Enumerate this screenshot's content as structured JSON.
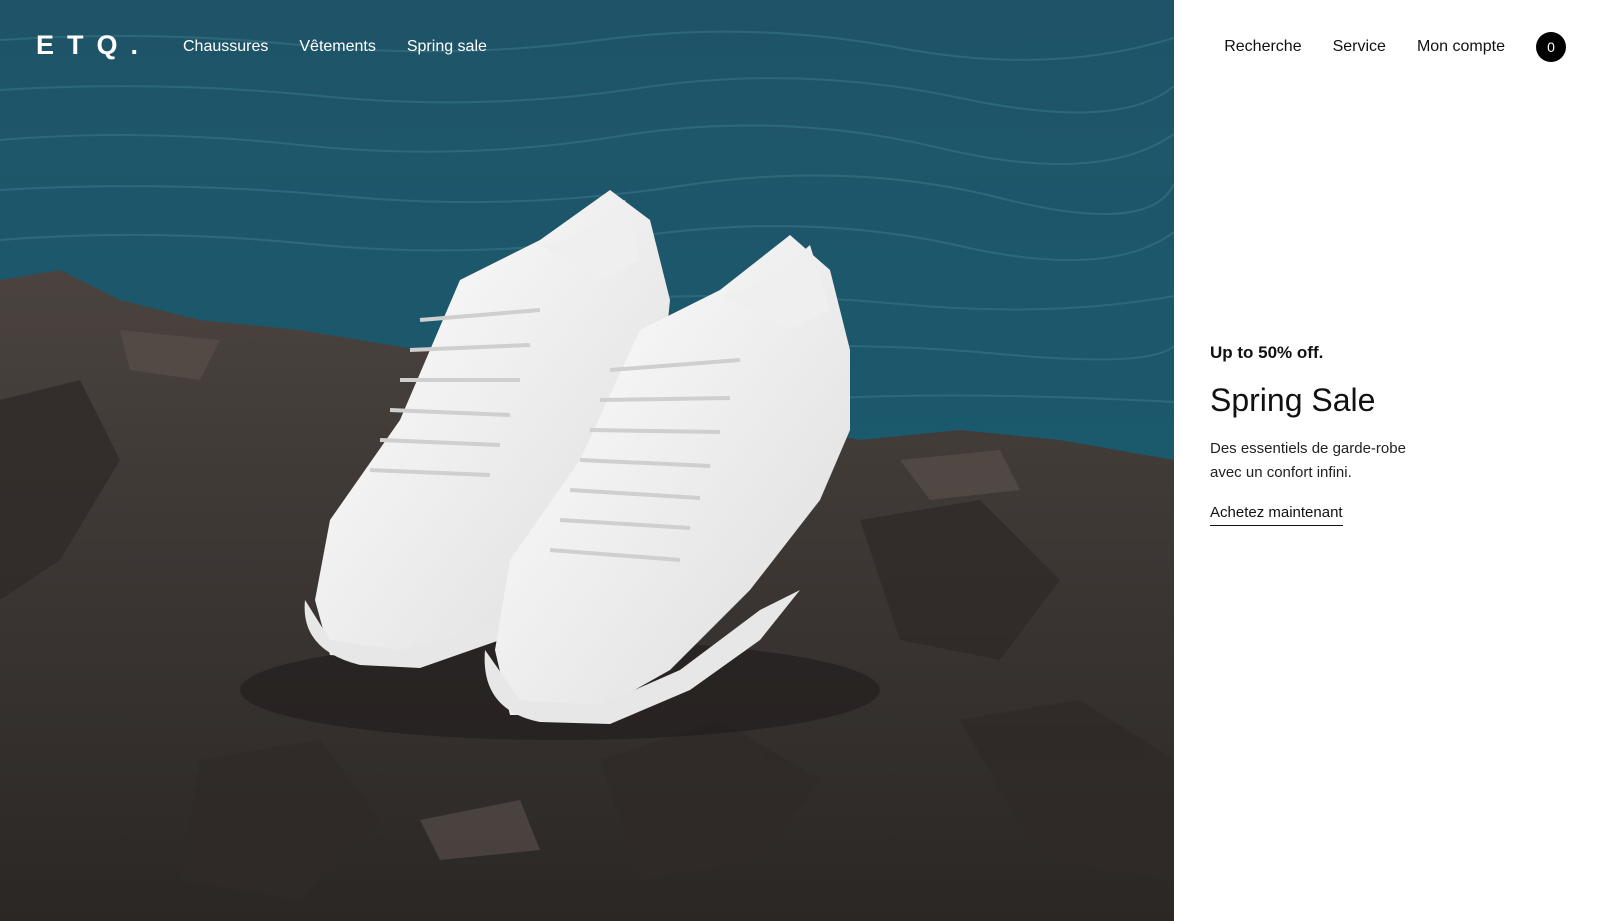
{
  "brand": {
    "logo_text": "ETQ."
  },
  "nav_left": [
    {
      "label": "Chaussures"
    },
    {
      "label": "Vêtements"
    },
    {
      "label": "Spring sale"
    }
  ],
  "nav_right": {
    "search_label": "Recherche",
    "service_label": "Service",
    "account_label": "Mon compte",
    "cart_count": "0"
  },
  "promo": {
    "kicker": "Up to 50% off.",
    "title": "Spring Sale",
    "description": "Des essentiels de garde-robe avec un confort infini.",
    "cta_label": "Achetez maintenant"
  },
  "colors": {
    "sea": "#1b4f62",
    "rock": "#3a3432",
    "accent_black": "#000000",
    "panel_bg": "#ffffff"
  }
}
